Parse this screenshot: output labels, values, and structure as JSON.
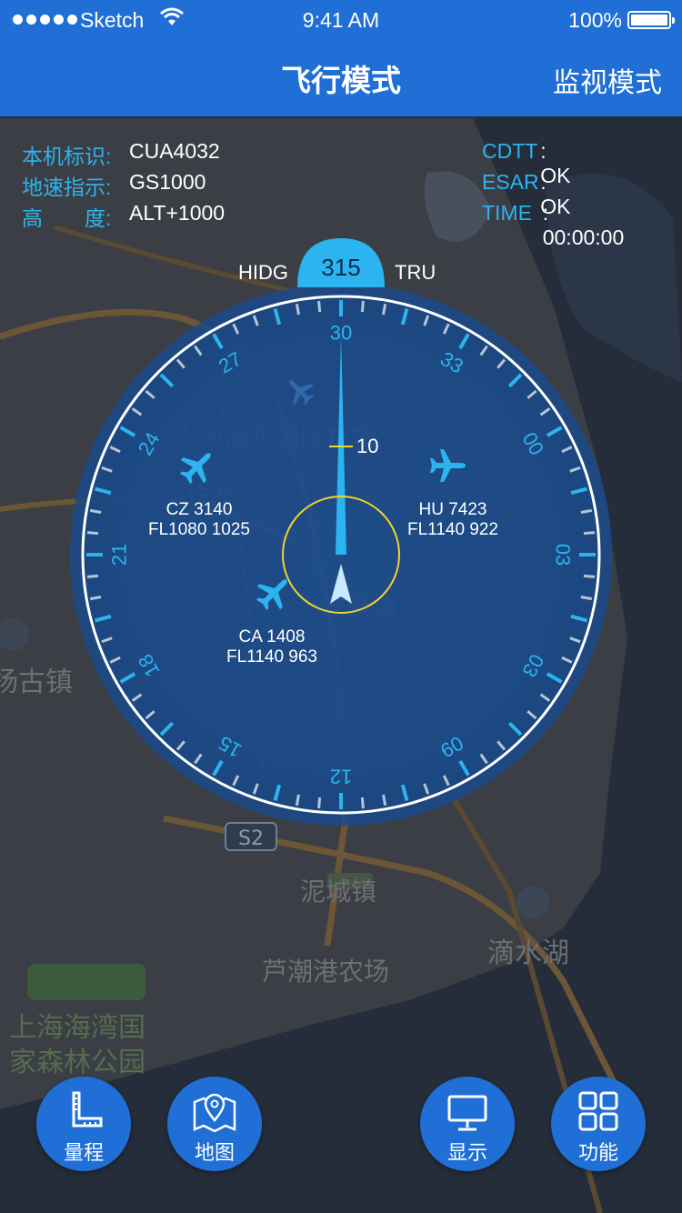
{
  "status_bar": {
    "carrier": "Sketch",
    "time": "9:41 AM",
    "battery": "100%"
  },
  "header": {
    "title": "飞行模式",
    "monitor_label": "监视模式"
  },
  "info_left": [
    {
      "label": "本机标识:",
      "value": "CUA4032"
    },
    {
      "label": "地速指示:",
      "value": "GS1000"
    },
    {
      "label": "高　　度:",
      "value": "ALT+1000"
    }
  ],
  "info_right": [
    {
      "label": "CDTT",
      "value": ": OK"
    },
    {
      "label": "ESAR",
      "value": ": OK"
    },
    {
      "label": "TIME",
      "value": ": 00:00:00"
    }
  ],
  "compass": {
    "heading": "315",
    "left_label": "HIDG",
    "right_label": "TRU",
    "range_label": "10",
    "dial_labels": [
      "30",
      "33",
      "00",
      "03",
      "03",
      "09",
      "12",
      "15",
      "18",
      "21",
      "24",
      "27"
    ]
  },
  "traffic": [
    {
      "callsign": "CZ 3140",
      "flight_level": "FL1080 1025"
    },
    {
      "callsign": "HU 7423",
      "flight_level": "FL1140 922"
    },
    {
      "callsign": "CA 1408",
      "flight_level": "FL1140 963"
    }
  ],
  "map_labels": [
    "上海浦东国际机场",
    "S32",
    "S2",
    "万祥镇",
    "老港镇",
    "泥城镇",
    "芦潮港农场",
    "滴水湖",
    "上海海湾国",
    "家森林公园",
    "杨古镇"
  ],
  "buttons": [
    {
      "label": "量程",
      "icon": "ruler-icon"
    },
    {
      "label": "地图",
      "icon": "map-pin-icon"
    },
    {
      "label": "显示",
      "icon": "monitor-icon"
    },
    {
      "label": "功能",
      "icon": "grid-icon"
    }
  ],
  "colors": {
    "header_blue": "#1f6fd6",
    "accent_cyan": "#2bb4ef",
    "range_ring": "#f2d22c",
    "dial_fill": "#1d4a86"
  }
}
